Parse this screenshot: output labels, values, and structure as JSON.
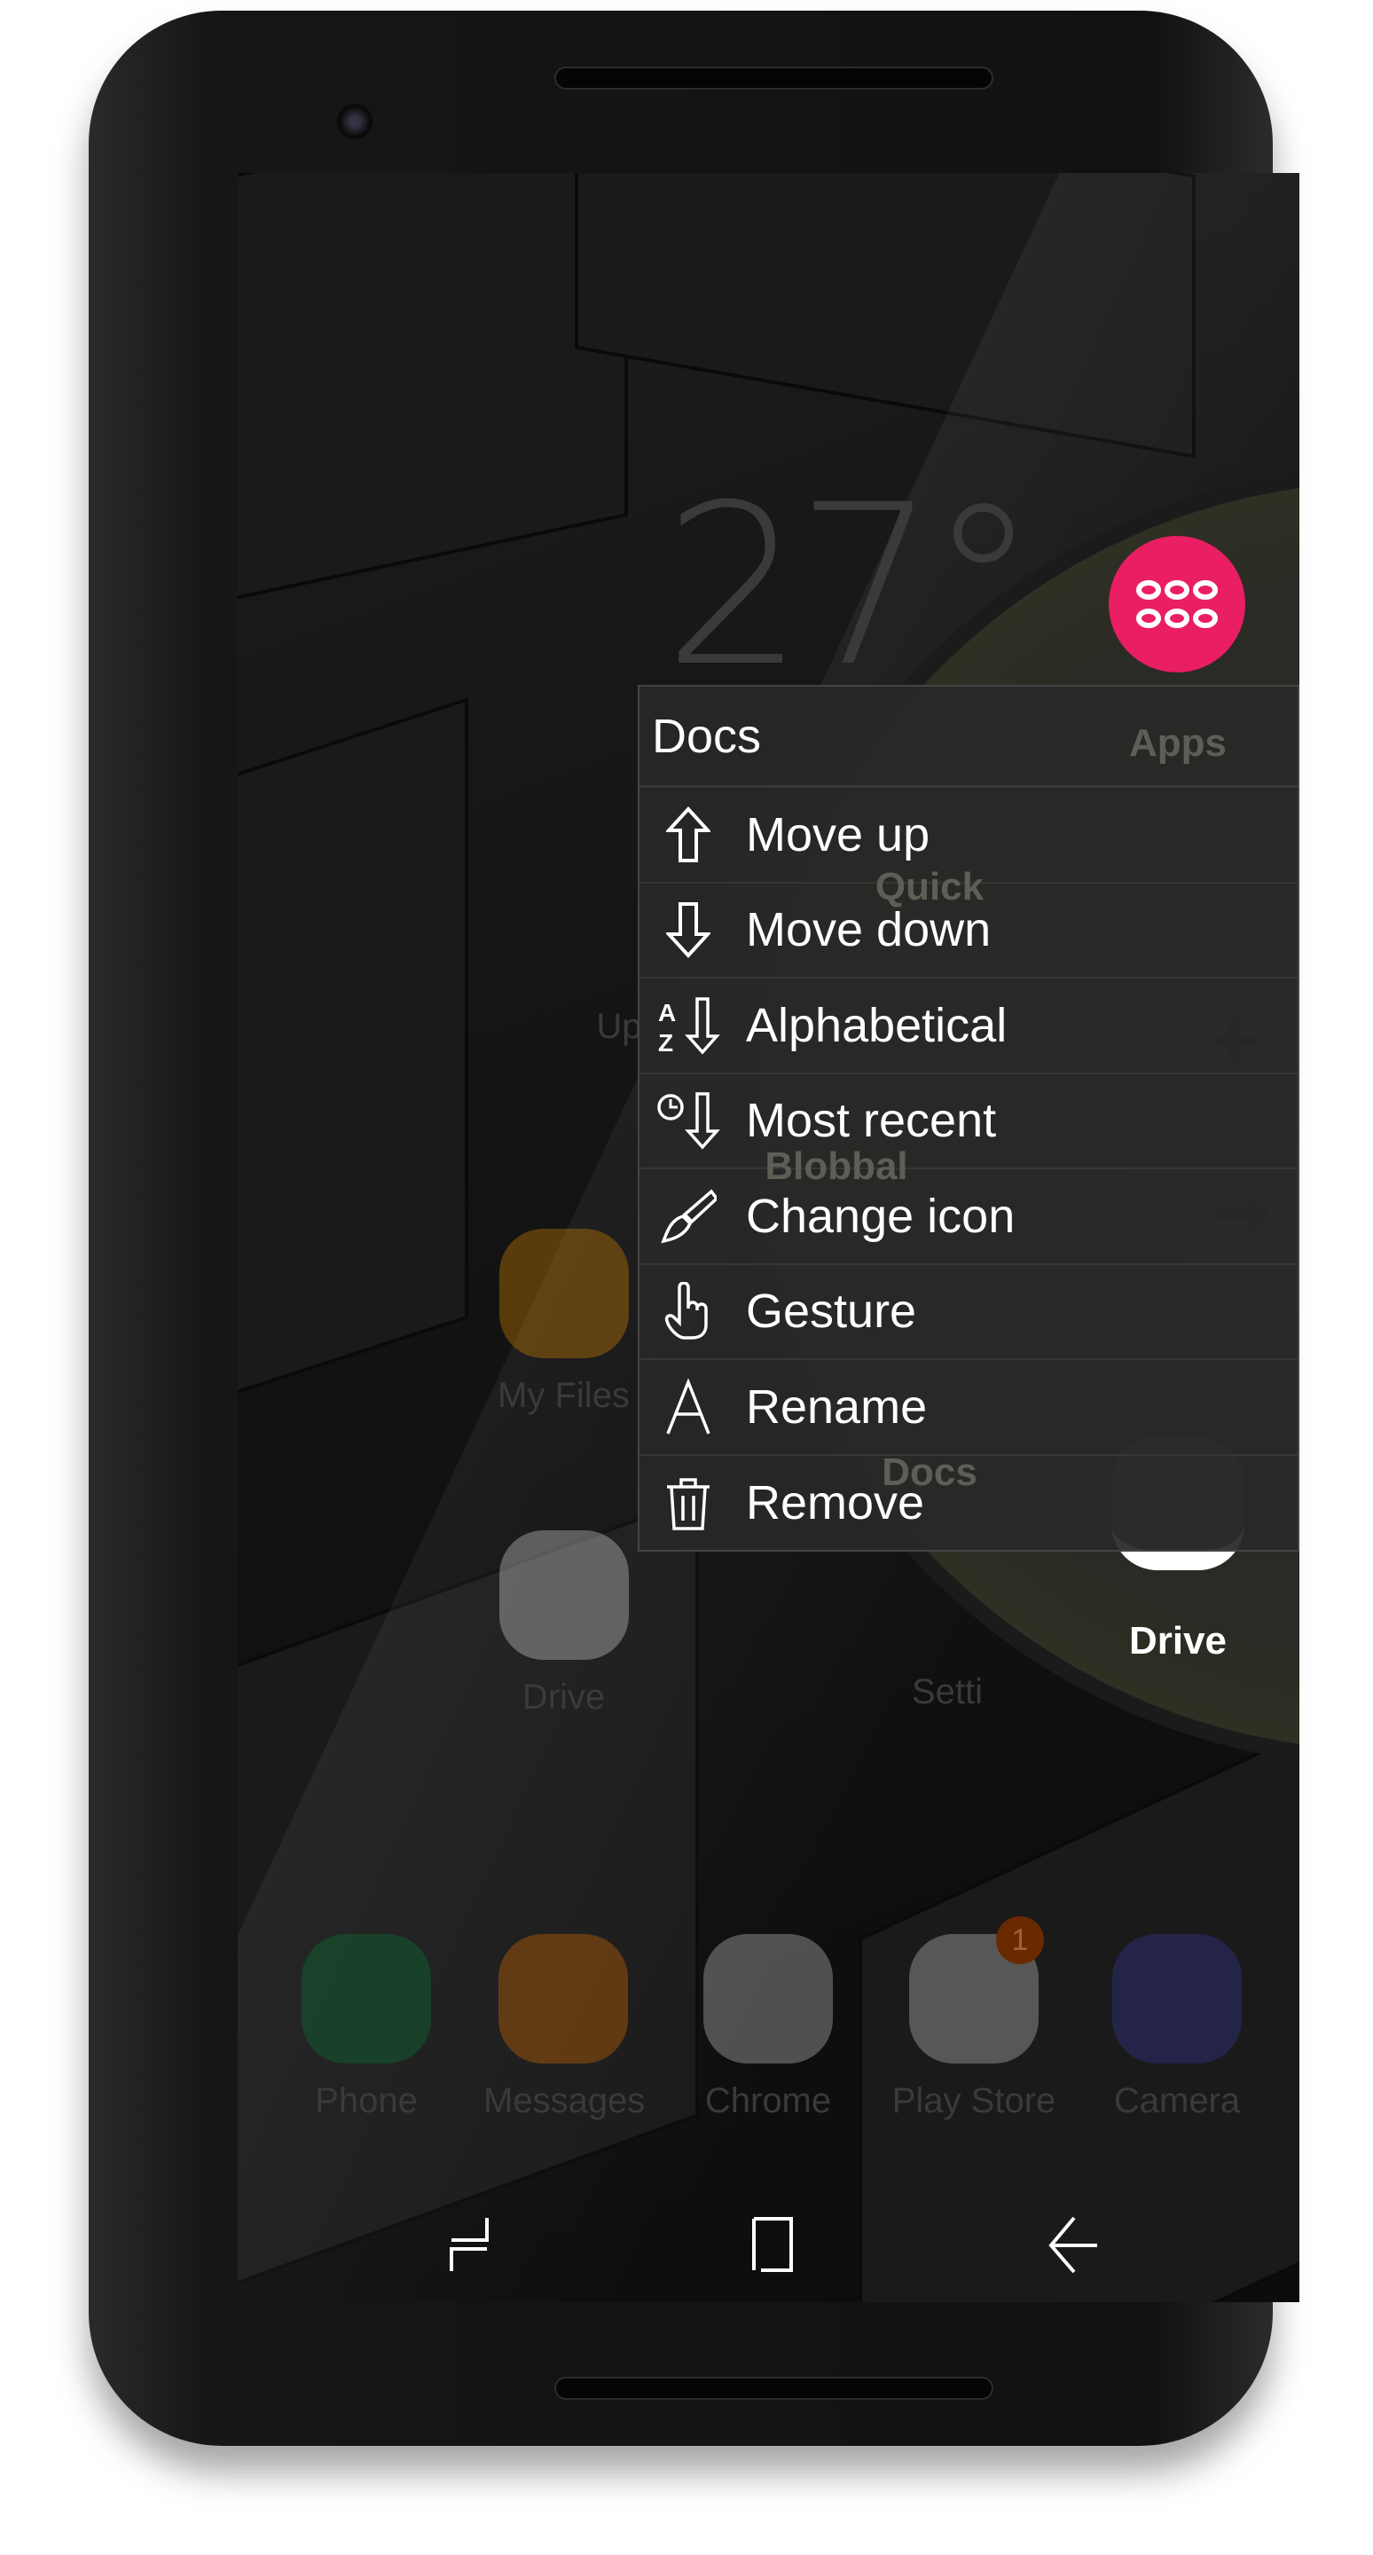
{
  "weather": {
    "temperature": "27°"
  },
  "background_apps": [
    {
      "label": "Up",
      "color": "#000000"
    },
    {
      "label": "My Files",
      "color": "#e08a00"
    },
    {
      "label": "Drive",
      "color": "#ffffff"
    },
    {
      "label": "Setti",
      "color": "#000000"
    }
  ],
  "circle_launcher": {
    "fab_icon": "app-drawer-grid-icon",
    "fab_color": "#e91e63",
    "ring_color": "#c8b820",
    "items": [
      {
        "label": "Apps"
      },
      {
        "label": "Quick"
      },
      {
        "label": "Blobbal"
      },
      {
        "label": "Docs"
      },
      {
        "label": "Drive"
      }
    ]
  },
  "context_menu": {
    "title": "Docs",
    "items": [
      {
        "label": "Move up",
        "icon": "arrow-up-outline-icon"
      },
      {
        "label": "Move down",
        "icon": "arrow-down-outline-icon"
      },
      {
        "label": "Alphabetical",
        "icon": "sort-alpha-icon"
      },
      {
        "label": "Most recent",
        "icon": "sort-recent-icon"
      },
      {
        "label": "Change icon",
        "icon": "paintbrush-icon"
      },
      {
        "label": "Gesture",
        "icon": "hand-pointer-icon"
      },
      {
        "label": "Rename",
        "icon": "letter-a-icon"
      },
      {
        "label": "Remove",
        "icon": "trash-icon"
      }
    ]
  },
  "dock": [
    {
      "label": "Phone",
      "color": "#0a7a3a"
    },
    {
      "label": "Messages",
      "color": "#e07000"
    },
    {
      "label": "Chrome",
      "color": "#dddddd"
    },
    {
      "label": "Play Store",
      "color": "#dddddd",
      "badge": "1"
    },
    {
      "label": "Camera",
      "color": "#3a3aa0"
    }
  ],
  "navbar": {
    "recents": "recents-icon",
    "home": "home-icon",
    "back": "back-icon"
  }
}
